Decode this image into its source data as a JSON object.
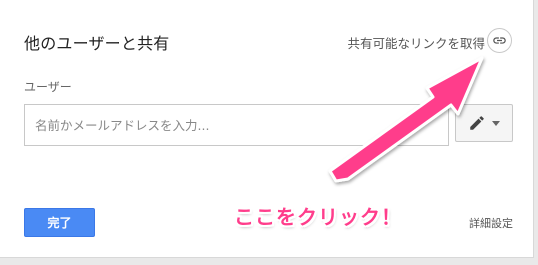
{
  "dialog": {
    "title": "他のユーザーと共有",
    "share_link_label": "共有可能なリンクを取得",
    "users_label": "ユーザー",
    "people_input": {
      "placeholder": "名前かメールアドレスを入力...",
      "value": ""
    },
    "permission_icon": "pencil-icon",
    "done_label": "完了",
    "advanced_label": "詳細設定"
  },
  "annotation": {
    "text": "ここをクリック！",
    "color": "#ff3d8b"
  },
  "colors": {
    "primary_button": "#4a8af4",
    "annotation_pink": "#ff3d8b"
  }
}
